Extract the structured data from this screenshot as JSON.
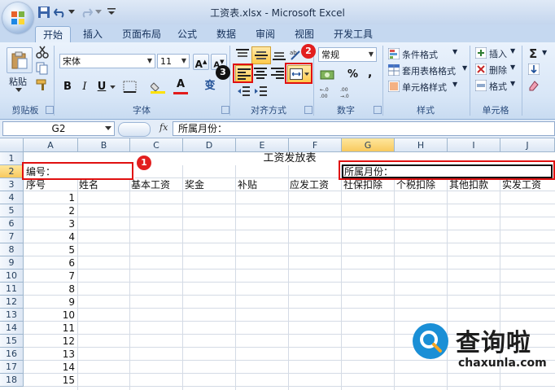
{
  "window": {
    "title": "工资表.xlsx - Microsoft Excel"
  },
  "tabs": [
    "开始",
    "插入",
    "页面布局",
    "公式",
    "数据",
    "审阅",
    "视图",
    "开发工具"
  ],
  "ribbon": {
    "clipboard": {
      "paste_label": "粘贴",
      "group_label": "剪贴板"
    },
    "font": {
      "font_name": "宋体",
      "font_size": "11",
      "group_label": "字体",
      "bold": "B",
      "italic": "I",
      "underline": "U",
      "font_color_glyph": "A",
      "wen_glyph": "变"
    },
    "alignment": {
      "group_label": "对齐方式"
    },
    "number": {
      "format": "常规",
      "group_label": "数字",
      "percent": "%",
      "comma": ","
    },
    "styles": {
      "conditional": "条件格式",
      "table_format": "套用表格格式",
      "cell_styles": "单元格样式",
      "group_label": "样式"
    },
    "cells": {
      "insert": "插入",
      "delete": "删除",
      "format": "格式",
      "group_label": "单元格"
    },
    "editing": {
      "sum_glyph": "Σ"
    },
    "badges": [
      "1",
      "2",
      "3"
    ]
  },
  "formula_bar": {
    "name_box": "G2",
    "fx": "fx",
    "content": "所属月份："
  },
  "columns": [
    "A",
    "B",
    "C",
    "D",
    "E",
    "F",
    "G",
    "H",
    "I",
    "J"
  ],
  "rows": [
    "1",
    "2",
    "3",
    "4",
    "5",
    "6",
    "7",
    "8",
    "9",
    "10",
    "11",
    "12",
    "13",
    "14",
    "15",
    "16",
    "17",
    "18"
  ],
  "cells": {
    "title": "工资发放表",
    "a2": "编号：",
    "g2": "所属月份：",
    "headers": [
      "序号",
      "姓名",
      "基本工资",
      "奖金",
      "补贴",
      "应发工资",
      "社保扣除",
      "个税扣除",
      "其他扣款",
      "实发工资"
    ],
    "serials": [
      "1",
      "2",
      "3",
      "4",
      "5",
      "6",
      "7",
      "8",
      "9",
      "10",
      "11",
      "12",
      "13",
      "14",
      "15"
    ]
  },
  "watermark": {
    "text": "查询啦",
    "url": "chaxunla.com"
  },
  "colors": {
    "highlight_red": "#e01010",
    "ribbon_blue": "#d8e6f7",
    "watermark_blue": "#1a8fd6"
  }
}
